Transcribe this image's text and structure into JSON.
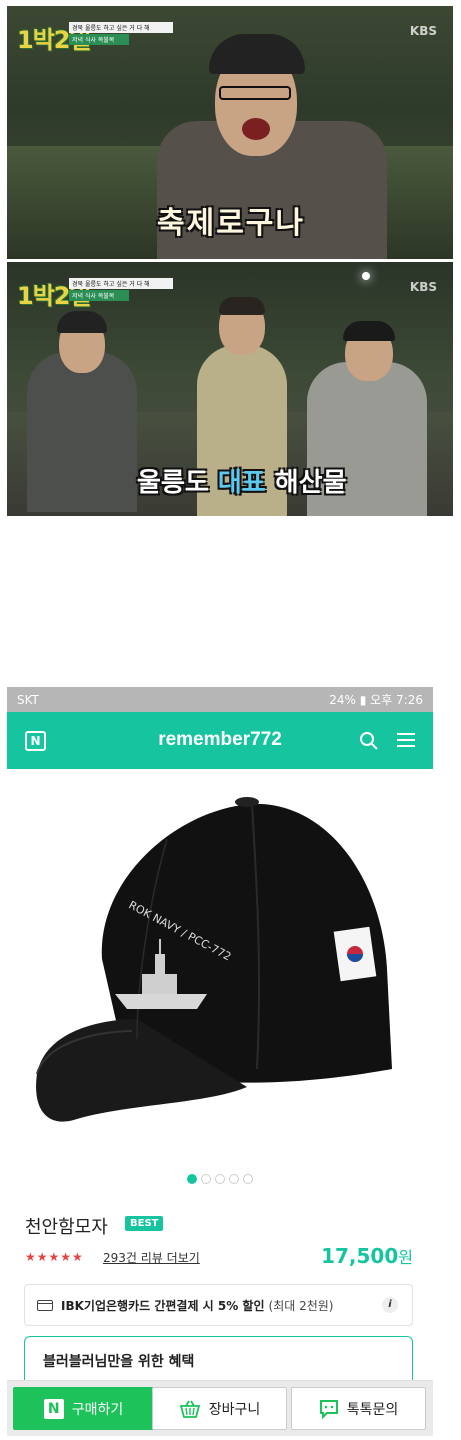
{
  "tv1": {
    "logo": "1박2일",
    "caption_top": "경북 울릉도 하고 싶은 거 다 해",
    "caption_bottom": "저녁 식사 복불복",
    "channel": "KBS",
    "subtitle": "축제로구나"
  },
  "tv2": {
    "logo": "1박2일",
    "caption_top": "경북 울릉도 하고 싶은 거 다 해",
    "caption_bottom": "저녁 식사 복불복",
    "channel": "KBS",
    "subtitle_a": "울릉도",
    "subtitle_b": "대표",
    "subtitle_c": "해산물"
  },
  "statusbar": {
    "carrier": "SKT",
    "right": "24% ▮ 오후 7:26"
  },
  "appbar": {
    "logo": "N",
    "title": "remember772"
  },
  "product": {
    "image_text": "ROK NAVY / PCC-772",
    "name": "천안함모자",
    "badge": "BEST",
    "stars": "★★★★★",
    "reviews": "293건 리뷰 더보기",
    "price": "17,500",
    "currency": "원",
    "carousel_count": 5,
    "carousel_active": 0
  },
  "card_promo": {
    "text": "IBK기업은행카드 간편결제 시 5% 할인",
    "sub": "(최대 2천원)",
    "info": "i"
  },
  "benefit": {
    "title": "블러블러님만을 위한 혜택"
  },
  "bottom": {
    "buy_icon": "N",
    "buy": "구매하기",
    "cart": "장바구니",
    "talk": "톡톡문의"
  },
  "colors": {
    "accent": "#16c5a0",
    "buy_green": "#1dc25b",
    "star_red": "#e54545"
  }
}
